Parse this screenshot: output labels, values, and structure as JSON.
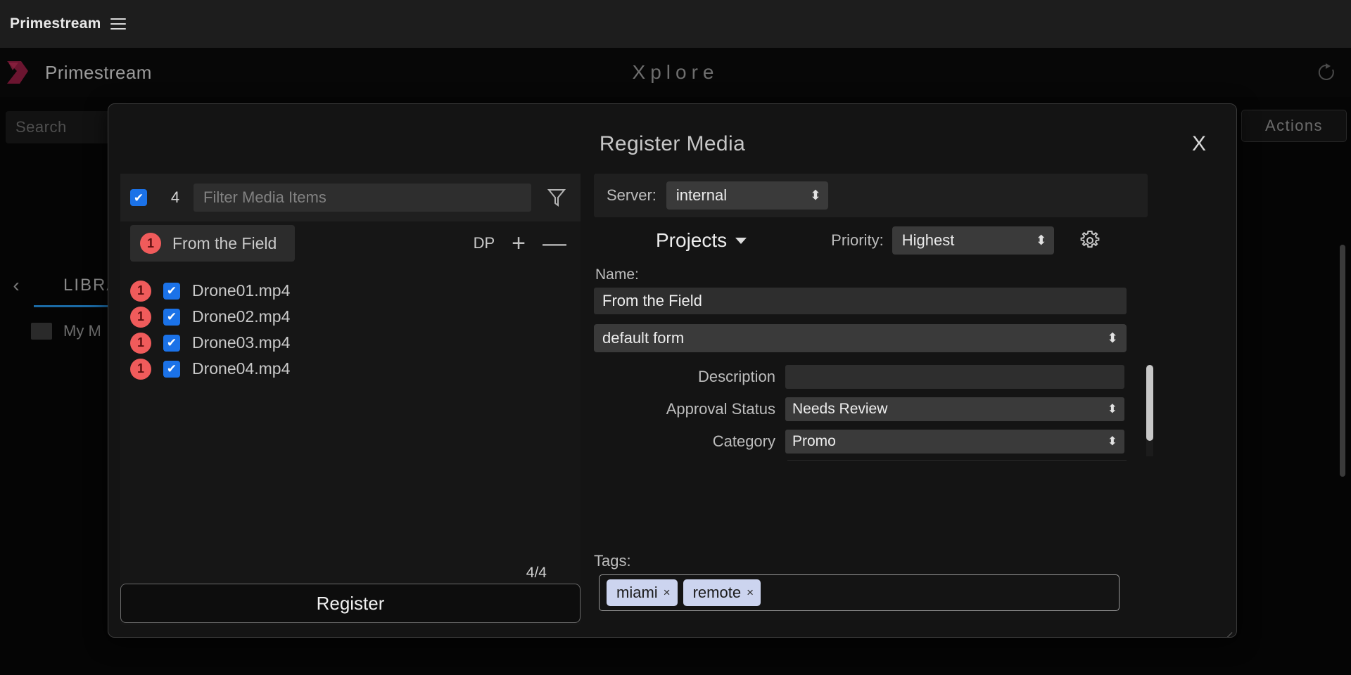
{
  "os_bar": {
    "title": "Primestream",
    "menu_icon": "hamburger-icon"
  },
  "app_header": {
    "brand": "Primestream",
    "app_title": "Xplore",
    "refresh_icon": "refresh-icon"
  },
  "background": {
    "search_placeholder": "Search",
    "actions_label": "Actions",
    "library_label": "LIBRA",
    "my_media_label": "My M",
    "back_icon": "chevron-left-icon",
    "accent_color": "#1b6aa5"
  },
  "modal": {
    "title": "Register Media",
    "close_label": "X",
    "left": {
      "select_all_checked": true,
      "selected_count": "4",
      "filter_placeholder": "Filter Media Items",
      "filter_icon": "funnel-icon",
      "group": {
        "badge": "1",
        "label": "From the Field"
      },
      "dp_label": "DP",
      "add_label": "+",
      "remove_label": "—",
      "files": [
        {
          "badge": "1",
          "checked": true,
          "name": "Drone01.mp4"
        },
        {
          "badge": "1",
          "checked": true,
          "name": "Drone02.mp4"
        },
        {
          "badge": "1",
          "checked": true,
          "name": "Drone03.mp4"
        },
        {
          "badge": "1",
          "checked": true,
          "name": "Drone04.mp4"
        }
      ],
      "count_label": "4/4",
      "register_label": "Register"
    },
    "right": {
      "server_label": "Server:",
      "server_value": "internal",
      "projects_label": "Projects",
      "priority_label": "Priority:",
      "priority_value": "Highest",
      "settings_icon": "gear-icon",
      "name_label": "Name:",
      "name_value": "From the Field",
      "form_value": "default form",
      "fields": [
        {
          "label": "Description",
          "value": "",
          "type": "text"
        },
        {
          "label": "Approval Status",
          "value": "Needs Review",
          "type": "select"
        },
        {
          "label": "Category",
          "value": "Promo",
          "type": "select"
        }
      ],
      "tags_label": "Tags:",
      "tags": [
        {
          "text": "miami",
          "remove": "×"
        },
        {
          "text": "remote",
          "remove": "×"
        }
      ]
    }
  },
  "colors": {
    "checkbox_blue": "#1b72e8",
    "badge_red": "#f05b5b",
    "tag_bg": "#ccd4ef"
  }
}
